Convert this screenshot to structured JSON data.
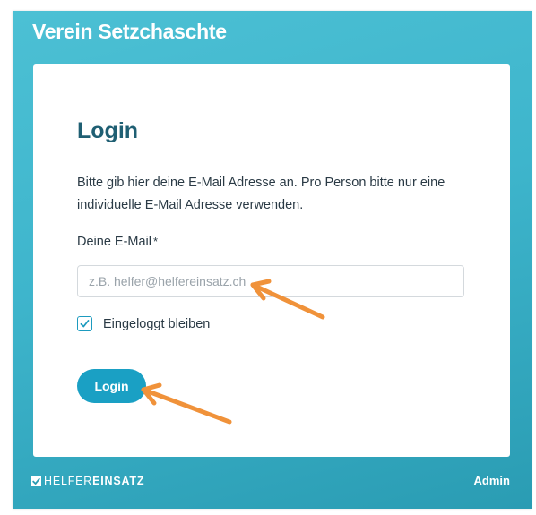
{
  "header": {
    "title": "Verein Setzchaschte"
  },
  "login": {
    "title": "Login",
    "instructions": "Bitte gib hier deine E-Mail Adresse an. Pro Person bitte nur eine individuelle E-Mail Adresse verwenden.",
    "email_label": "Deine E-Mail",
    "email_required_marker": "*",
    "email_placeholder": "z.B. helfer@helfereinsatz.ch",
    "email_value": "",
    "remember_label": "Eingeloggt bleiben",
    "remember_checked": true,
    "submit_label": "Login"
  },
  "footer": {
    "brand_light": "HELFER",
    "brand_bold": "EINSATZ",
    "brand_icon": "checkmark-icon",
    "admin_link": "Admin"
  },
  "colors": {
    "accent": "#1aa0c4",
    "background_gradient_start": "#4cc0d4",
    "background_gradient_end": "#2a9cb3",
    "title_color": "#1f5f73",
    "annotation_arrow": "#f0923a"
  },
  "annotations": [
    {
      "type": "arrow",
      "target": "email-input"
    },
    {
      "type": "arrow",
      "target": "login-button"
    }
  ]
}
